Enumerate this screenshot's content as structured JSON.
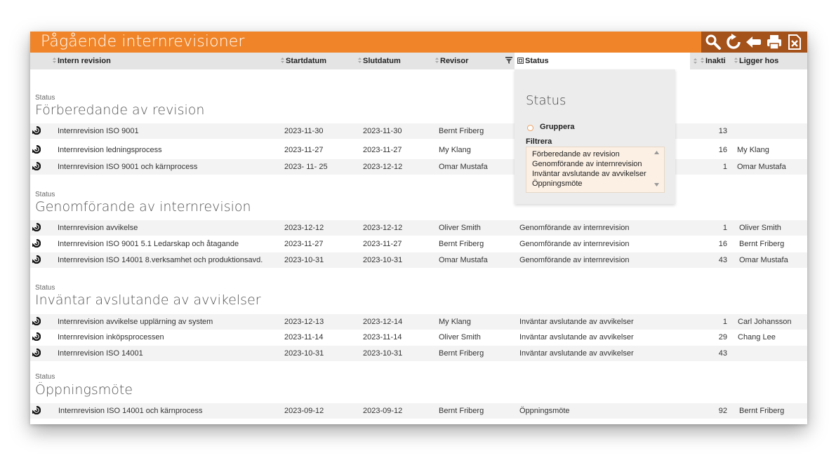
{
  "window": {
    "title": "Pågående internrevisioner"
  },
  "toolbar": {
    "icons": [
      "search-icon",
      "refresh-icon",
      "back-icon",
      "print-icon",
      "excel-export-icon"
    ]
  },
  "columns": {
    "intern_revision": "Intern revision",
    "startdatum": "Startdatum",
    "slutdatum": "Slutdatum",
    "revisor": "Revisor",
    "status": "Status",
    "inakti": "Inakti",
    "ligger_hos": "Ligger hos"
  },
  "groups": [
    {
      "label": "Status",
      "title": "Förberedande av revision",
      "rows": [
        {
          "name": "Internrevision  ISO 9001",
          "start": "2023-11-30",
          "end": "2023-11-30",
          "revisor": "Bernt Friberg",
          "status": "",
          "inakti": "13",
          "ligger_hos": ""
        },
        {
          "name": "Internrevision ledningsprocess",
          "start": "2023-11-27",
          "end": "2023-11-27",
          "revisor": "My Klang",
          "status": "",
          "inakti": "16",
          "ligger_hos": "My Klang"
        },
        {
          "name": "Internrevision ISO 9001 och kärnprocess",
          "start": "2023- 11- 25",
          "end": "2023-12-12",
          "revisor": "Omar Mustafa",
          "status": "",
          "inakti": "1",
          "ligger_hos": "Omar Mustafa"
        }
      ]
    },
    {
      "label": "Status",
      "title": "Genomförande av internrevision",
      "rows": [
        {
          "name": "Internrevision avvikelse",
          "start": "2023-12-12",
          "end": "2023-12-12",
          "revisor": "Oliver Smith",
          "status": "Genomförande av internrevision",
          "inakti": "1",
          "ligger_hos": "Oliver Smith"
        },
        {
          "name": "Internrevision  ISO 9001 5.1 Ledarskap och åtagande",
          "start": "2023-11-27",
          "end": "2023-11-27",
          "revisor": "Bernt Friberg",
          "status": "Genomförande av internrevision",
          "inakti": "16",
          "ligger_hos": "Bernt Friberg"
        },
        {
          "name": "Internrevision  ISO 14001 8.verksamhet och produktionsavd.",
          "start": "2023-10-31",
          "end": "2023-10-31",
          "revisor": "Omar Mustafa",
          "status": "Genomförande av internrevision",
          "inakti": "43",
          "ligger_hos": "Omar Mustafa"
        }
      ]
    },
    {
      "label": "Status",
      "title": "Inväntar avslutande av avvikelser",
      "rows": [
        {
          "name": "Internrevision avvikelse upplärning av system",
          "start": "2023-12-13",
          "end": "2023-12-14",
          "revisor": "My Klang",
          "status": "Inväntar avslutande av avvikelser",
          "inakti": "1",
          "ligger_hos": "Carl Johansson"
        },
        {
          "name": "Internrevision inköpsprocessen",
          "start": "2023-11-14",
          "end": "2023-11-14",
          "revisor": "Oliver Smith",
          "status": "Inväntar avslutande av avvikelser",
          "inakti": "29",
          "ligger_hos": "Chang Lee"
        },
        {
          "name": "Internrevision ISO 14001",
          "start": "2023-10-31",
          "end": "2023-10-31",
          "revisor": "Bernt Friberg",
          "status": "Inväntar avslutande av avvikelser",
          "inakti": "43",
          "ligger_hos": ""
        }
      ]
    },
    {
      "label": "Status",
      "title": "Öppningsmöte",
      "rows": [
        {
          "name": "Internrevision ISO 14001 och kärnprocess",
          "start": "2023-09-12",
          "end": "2023-09-12",
          "revisor": "Bernt Friberg",
          "status": "Öppningsmöte",
          "inakti": "92",
          "ligger_hos": "Bernt Friberg"
        }
      ]
    }
  ],
  "status_popup": {
    "title": "Status",
    "group_label": "Gruppera",
    "filter_label": "Filtrera",
    "options": [
      "Förberedande av revision",
      "Genomförande av internrevision",
      "Inväntar avslutande av avvikelser",
      "Öppningsmöte"
    ]
  },
  "colors": {
    "title_bar": "#f08428",
    "toolbar": "#a4511a",
    "header": "#e4e4e4",
    "row_shade": "#f3f3f3",
    "popup": "#ececec",
    "listbox": "#fcf0e4"
  }
}
